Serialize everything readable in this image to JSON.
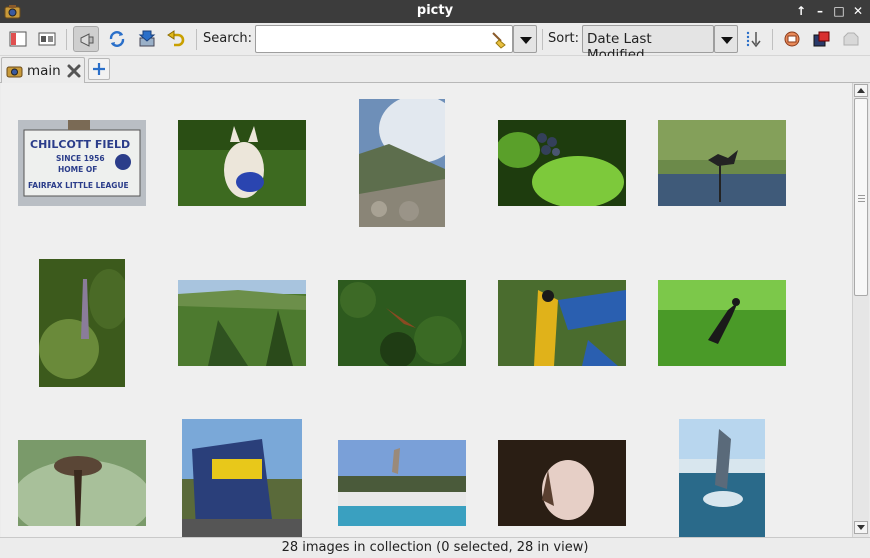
{
  "window": {
    "title": "picty",
    "controls": [
      "↑",
      "–",
      "□",
      "✕"
    ]
  },
  "toolbar": {
    "search_label": "Search:",
    "search_value": "",
    "search_placeholder": "",
    "sort_label": "Sort:",
    "sort_value": "Date Last Modified"
  },
  "tabs": [
    {
      "label": "main",
      "active": true
    }
  ],
  "status": "28 images in collection (0 selected, 28 in view)",
  "colors": {
    "titlebar": "#3c3c3c",
    "background": "#efefef",
    "accent": "#2a6fc9"
  },
  "images": [
    {
      "name": "image-chilcott-field-sign",
      "palette": [
        "#c9cdd2",
        "#e8e8e6",
        "#2b3d8a",
        "#7a6a55"
      ],
      "sign_lines": [
        "CHILCOTT FIELD",
        "SINCE 1956",
        "HOME OF",
        "FAIRFAX LITTLE LEAGUE"
      ]
    },
    {
      "name": "image-dog-with-toy",
      "palette": [
        "#2f5a1b",
        "#4c7a2a",
        "#e9e3d6",
        "#2a45b0"
      ]
    },
    {
      "name": "image-misty-mountain",
      "palette": [
        "#6e8fb8",
        "#dfe6ee",
        "#5d6e4d",
        "#9a9488"
      ]
    },
    {
      "name": "image-berries-leaves",
      "palette": [
        "#1e3c0e",
        "#7dc93b",
        "#b6dd6a",
        "#333a4a"
      ]
    },
    {
      "name": "image-anhinga-in-marsh",
      "palette": [
        "#6c8a4a",
        "#3f5a79",
        "#232323",
        "#8fa66a"
      ]
    },
    {
      "name": "image-plant-flower-spike",
      "palette": [
        "#3c5a1c",
        "#6a8a3a",
        "#8a7c9a",
        "#2a3a14"
      ]
    },
    {
      "name": "image-forested-valley",
      "palette": [
        "#a8c4de",
        "#4d7a2f",
        "#2f5220",
        "#6c8f4a"
      ]
    },
    {
      "name": "image-hawk-over-forest",
      "palette": [
        "#2d5a1e",
        "#4a7a2e",
        "#8a4a22",
        "#1f3c14"
      ]
    },
    {
      "name": "image-macaw-parrot",
      "palette": [
        "#4a6c2e",
        "#e0b21a",
        "#2a5fb0",
        "#1a1a1a"
      ]
    },
    {
      "name": "image-bird-in-grass",
      "palette": [
        "#4a9a28",
        "#7cc84a",
        "#1a1a1a",
        "#2e6a18"
      ]
    },
    {
      "name": "image-lotus-seed-pod",
      "palette": [
        "#6a8a5a",
        "#a8c09a",
        "#5a4636",
        "#3a2a1e"
      ]
    },
    {
      "name": "image-csx-locomotive",
      "palette": [
        "#7aa8d8",
        "#e8c81a",
        "#2a3f7a",
        "#555555"
      ]
    },
    {
      "name": "image-dolphin-show",
      "palette": [
        "#7aa0d8",
        "#3aa0c0",
        "#e8e8e8",
        "#4a5a3a"
      ]
    },
    {
      "name": "image-flamingo-portrait",
      "palette": [
        "#2a1e14",
        "#e6cfc6",
        "#5a4030",
        "#8a6a4a"
      ]
    },
    {
      "name": "image-dolphin-jump",
      "palette": [
        "#b8d6ee",
        "#2a6a8a",
        "#d8e6ee",
        "#5a6a7a"
      ]
    }
  ]
}
